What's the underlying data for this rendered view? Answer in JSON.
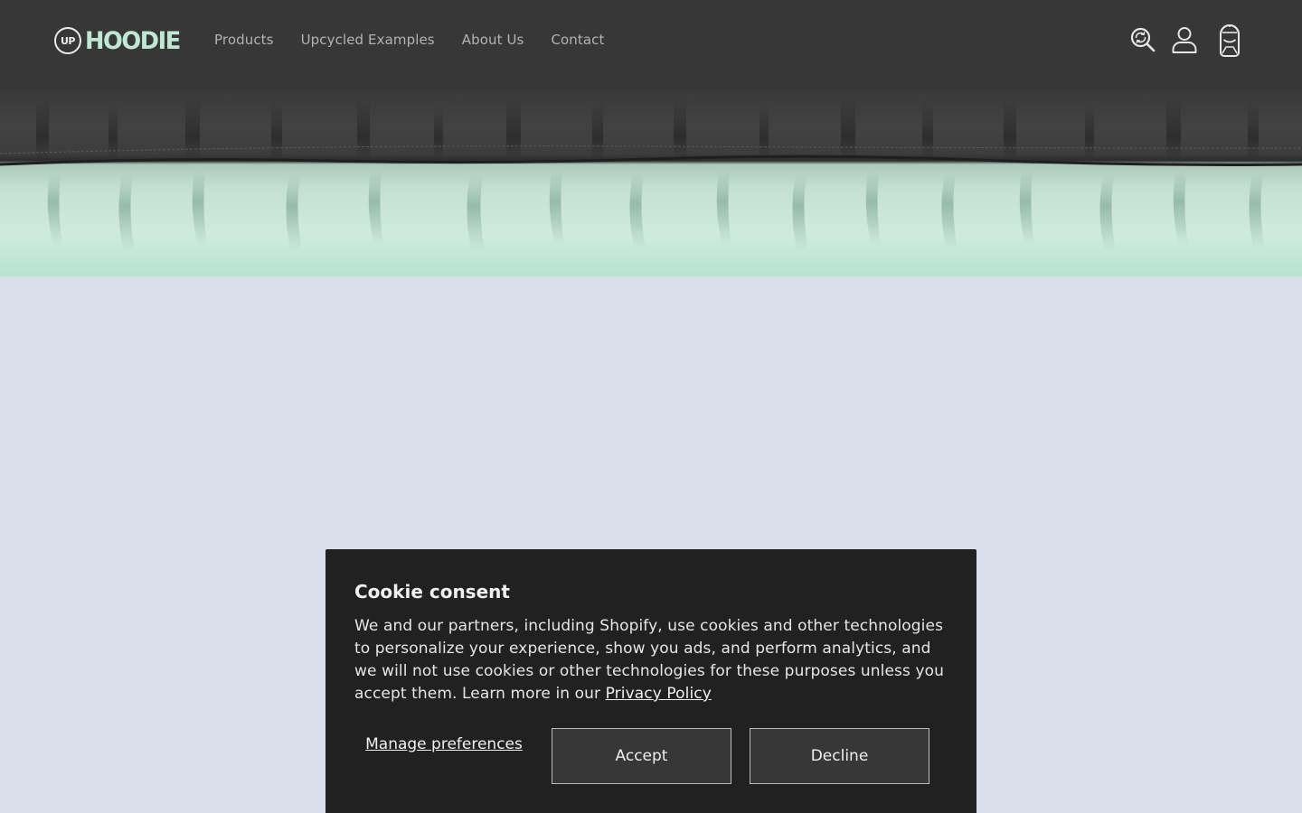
{
  "header": {
    "logo": {
      "badge_text": "UP",
      "wordmark": "HOODIE"
    },
    "nav": [
      {
        "label": "Products"
      },
      {
        "label": "Upcycled Examples"
      },
      {
        "label": "About Us"
      },
      {
        "label": "Contact"
      }
    ],
    "icons": [
      "search-icon",
      "account-icon",
      "cart-icon"
    ]
  },
  "colors": {
    "header_bg": "#373737",
    "brand_mint": "#bfe7d6",
    "page_bg": "#d8dfe9",
    "dialog_bg": "#212121",
    "button_bg": "#373737"
  },
  "cookie_consent": {
    "title": "Cookie consent",
    "body": "We and our partners, including Shopify, use cookies and other technologies to personalize your experience, show you ads, and perform analytics, and we will not use cookies or other technologies for these purposes unless you accept them. Learn more in our ",
    "privacy_link": "Privacy Policy",
    "manage_label": "Manage preferences",
    "accept_label": "Accept",
    "decline_label": "Decline"
  }
}
